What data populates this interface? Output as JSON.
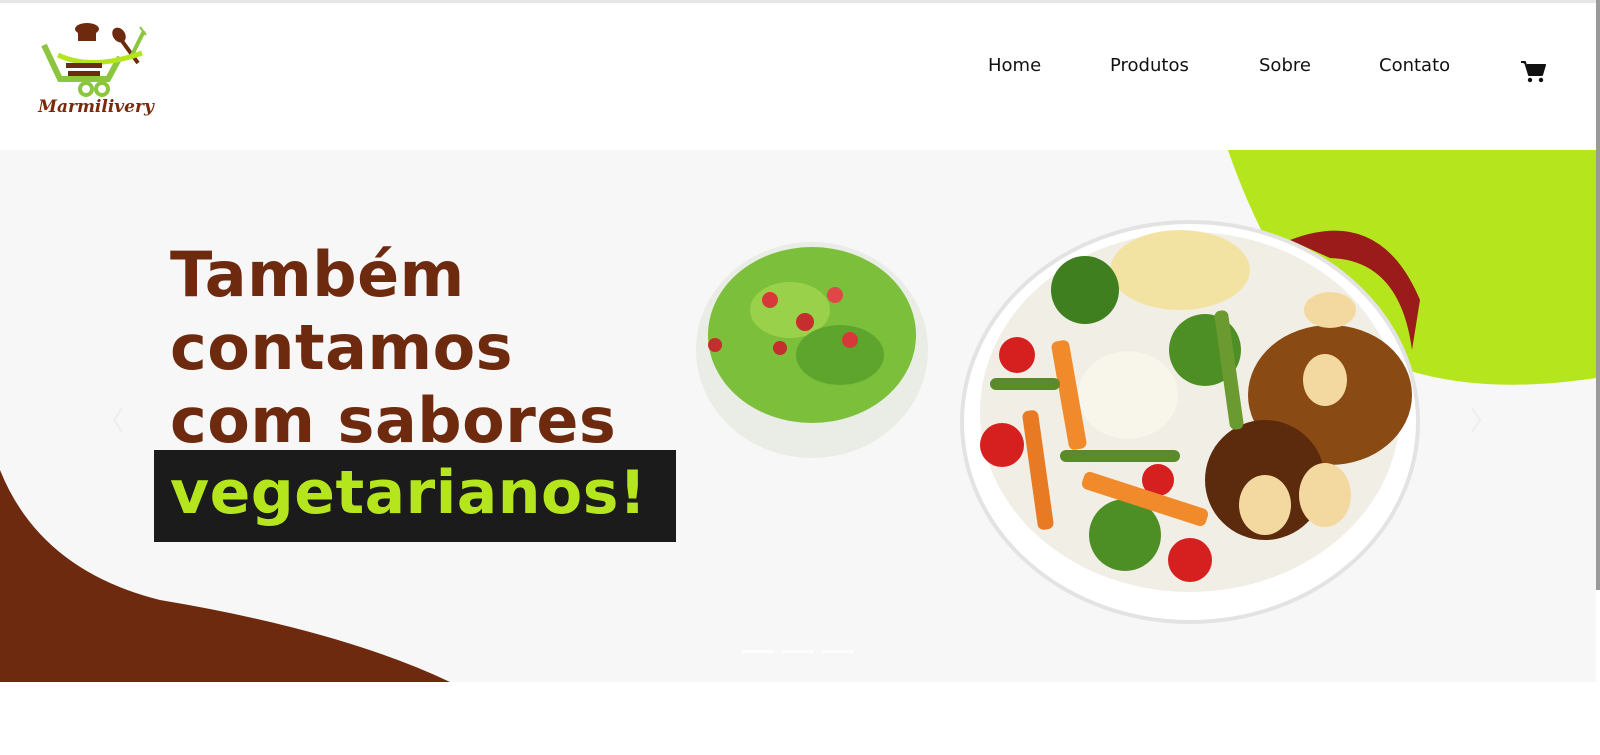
{
  "brand": {
    "name": "Marmilivery"
  },
  "nav": {
    "items": [
      "Home",
      "Produtos",
      "Sobre",
      "Contato"
    ],
    "cart_icon": "cart-icon"
  },
  "hero": {
    "headline_lines": [
      "Também",
      "contamos",
      "com sabores"
    ],
    "highlight": "vegetarianos!",
    "colors": {
      "brown": "#6e2a0f",
      "lime": "#b5e61d",
      "dark": "#1b1b1b",
      "red": "#9b1b1b"
    },
    "carousel": {
      "slide_count": 3,
      "active_index": 0,
      "prev_icon": "chevron-left-icon",
      "next_icon": "chevron-right-icon"
    }
  }
}
